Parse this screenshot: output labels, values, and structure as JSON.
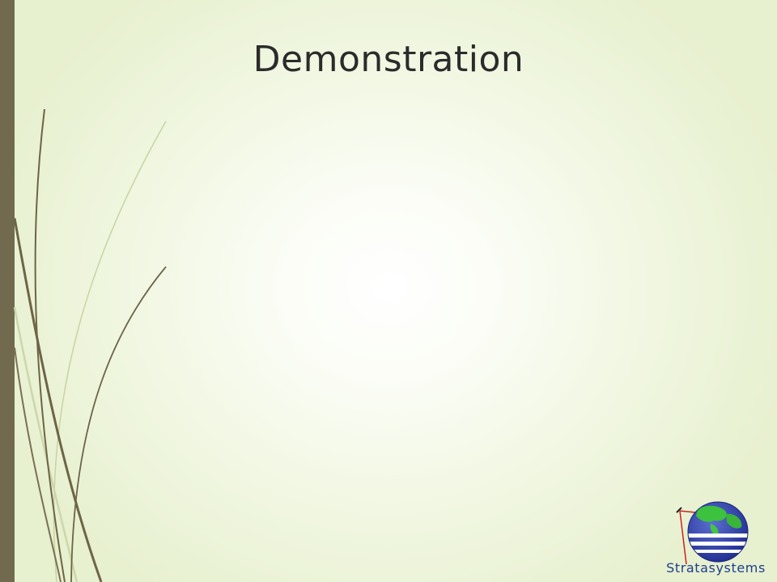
{
  "slide": {
    "title": "Demonstration"
  },
  "logo": {
    "text": "Stratasystems",
    "icon": "globe-icon"
  },
  "colors": {
    "sidebar": "#716a4f",
    "grass_dark": "#6e6447",
    "grass_light": "#c9d3a3",
    "title": "#2b2b2b",
    "logo_text": "#1f3f8f",
    "background_edge": "#e7f0cf"
  }
}
